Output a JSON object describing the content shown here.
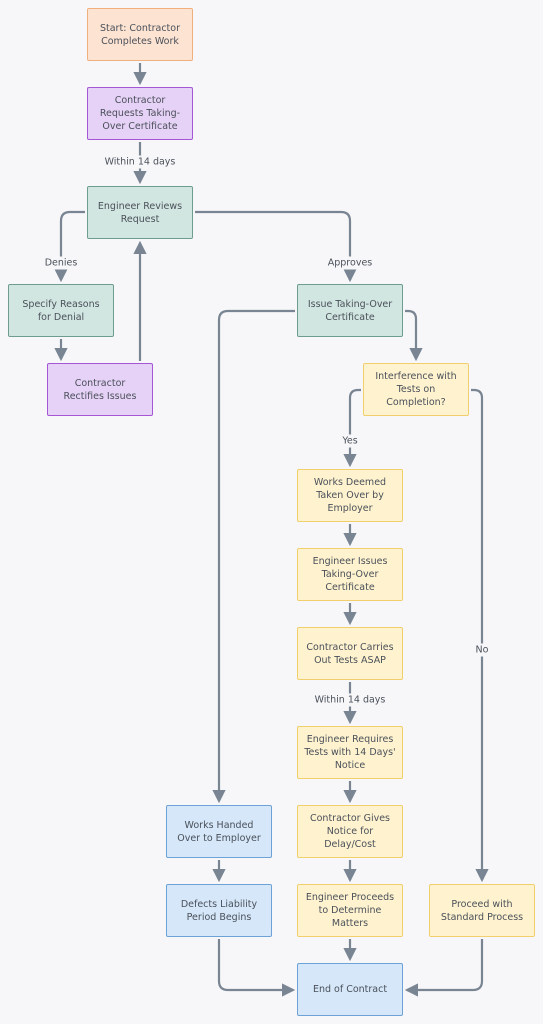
{
  "colors": {
    "edge": "#7a8593",
    "orange": "#fde3d2",
    "purple": "#e6d2f6",
    "teal": "#d2e6e1",
    "yellow": "#fff3cf",
    "blue": "#d5e7f8"
  },
  "nodes": {
    "start": "Start: Contractor Completes Work",
    "request": "Contractor Requests Taking-Over Certificate",
    "review": "Engineer Reviews Request",
    "specify": "Specify Reasons for Denial",
    "rectify": "Contractor Rectifies Issues",
    "issue": "Issue Taking-Over Certificate",
    "interference": "Interference with Tests on Completion?",
    "deemed": "Works Deemed Taken Over by Employer",
    "engineer_issues": "Engineer Issues Taking-Over Certificate",
    "carries": "Contractor Carries Out Tests ASAP",
    "requires": "Engineer Requires Tests with 14 Days' Notice",
    "gives": "Contractor Gives Notice for Delay/Cost",
    "proceeds": "Engineer Proceeds to Determine Matters",
    "standard": "Proceed with Standard Process",
    "handed": "Works Handed Over to Employer",
    "defects": "Defects Liability Period Begins",
    "end": "End of Contract"
  },
  "edge_labels": {
    "within1": "Within 14 days",
    "denies": "Denies",
    "approves": "Approves",
    "yes": "Yes",
    "no": "No",
    "within2": "Within 14 days"
  }
}
